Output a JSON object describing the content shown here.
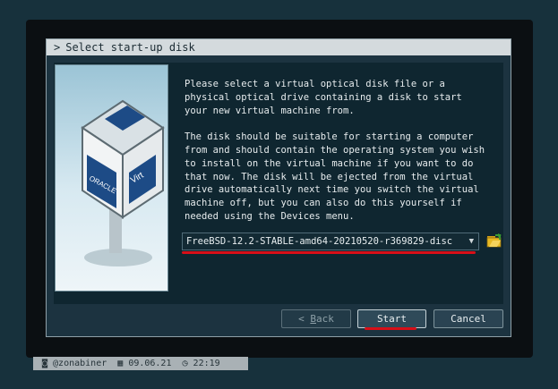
{
  "dialog": {
    "title": "Select start-up disk",
    "title_prefix": ">",
    "paragraphs": [
      "Please select a virtual optical disk file or a\nphysical optical drive containing a disk to start\nyour new virtual machine from.",
      "The disk should be suitable for starting a computer\nfrom and should contain the operating system you wish\nto install on the virtual machine if you want to do\nthat now. The disk will be ejected from the virtual\ndrive automatically next time you switch the virtual\nmachine off, but you can also do this yourself if\nneeded using the Devices menu."
    ],
    "disk_select": {
      "value": "FreeBSD-12.2-STABLE-amd64-20210520-r369829-disc"
    },
    "buttons": {
      "back_prefix": "< ",
      "back_accel": "B",
      "back_rest": "ack",
      "start": "Start",
      "cancel": "Cancel"
    },
    "image_brand_text": "ORACLE",
    "image_side_text": "Virt"
  },
  "status_bar": {
    "user": "@zonabiner",
    "date": "09.06.21",
    "time": "22:19"
  },
  "colors": {
    "highlight": "#d80f18",
    "background": "#17313c"
  },
  "icons": [
    "camera-icon",
    "calendar-icon",
    "clock-icon",
    "folder-open-icon",
    "chevron-down-icon"
  ]
}
